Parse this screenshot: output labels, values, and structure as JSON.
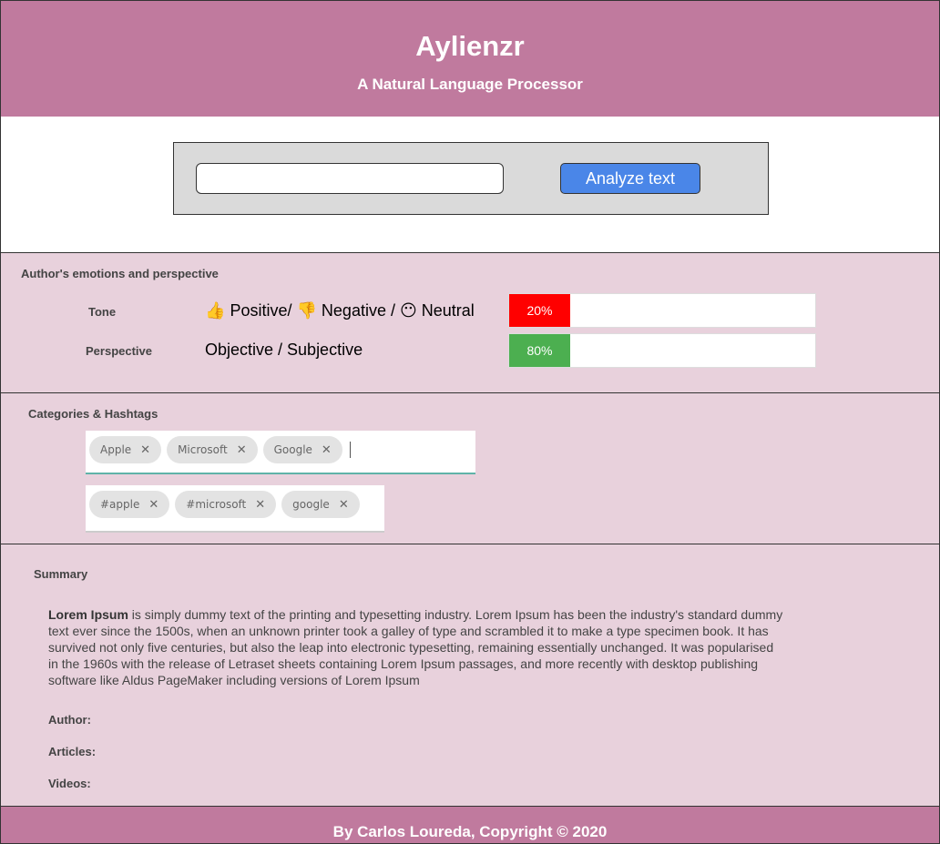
{
  "header": {
    "title": "Aylienzr",
    "subtitle": "A Natural Language Processor"
  },
  "input": {
    "value": "",
    "placeholder": "",
    "button_label": "Analyze text"
  },
  "emotions": {
    "title": "Author's emotions and perspective",
    "tone": {
      "label": "Tone",
      "positive_emoji": "👍",
      "positive": "Positive/",
      "negative_emoji": "👎",
      "negative": "Negative /",
      "neutral_emoji": "😶",
      "neutral": "Neutral",
      "percent": 20,
      "percent_label": "20%",
      "color": "#ff0000"
    },
    "perspective": {
      "label": "Perspective",
      "value": "Objective / Subjective",
      "percent": 80,
      "percent_label": "80%",
      "color": "#4caf50"
    }
  },
  "categories": {
    "title": "Categories & Hashtags",
    "tags": [
      "Apple",
      "Microsoft",
      "Google"
    ],
    "hashtags": [
      "#apple",
      "#microsoft",
      "google"
    ],
    "remove_glyph": "✕"
  },
  "summary": {
    "title": "Summary",
    "lead": "Lorem Ipsum",
    "body": " is simply dummy text of the printing and typesetting industry. Lorem Ipsum has been the industry's standard dummy text ever since the 1500s, when an unknown printer took a galley of type and scrambled it to make a type specimen book. It has survived not only five centuries, but also the leap into electronic typesetting, remaining essentially unchanged. It was popularised in the 1960s with the release of Letraset sheets containing Lorem Ipsum passages, and more recently with desktop publishing software like Aldus PageMaker including versions of Lorem Ipsum",
    "author_label": "Author:",
    "articles_label": "Articles:",
    "videos_label": "Videos:"
  },
  "footer": {
    "text": "By Carlos Loureda, Copyright © 2020"
  },
  "colors": {
    "header_bg": "#c07a9e",
    "section_bg": "#e8d1dc",
    "button_bg": "#4a86e8"
  }
}
